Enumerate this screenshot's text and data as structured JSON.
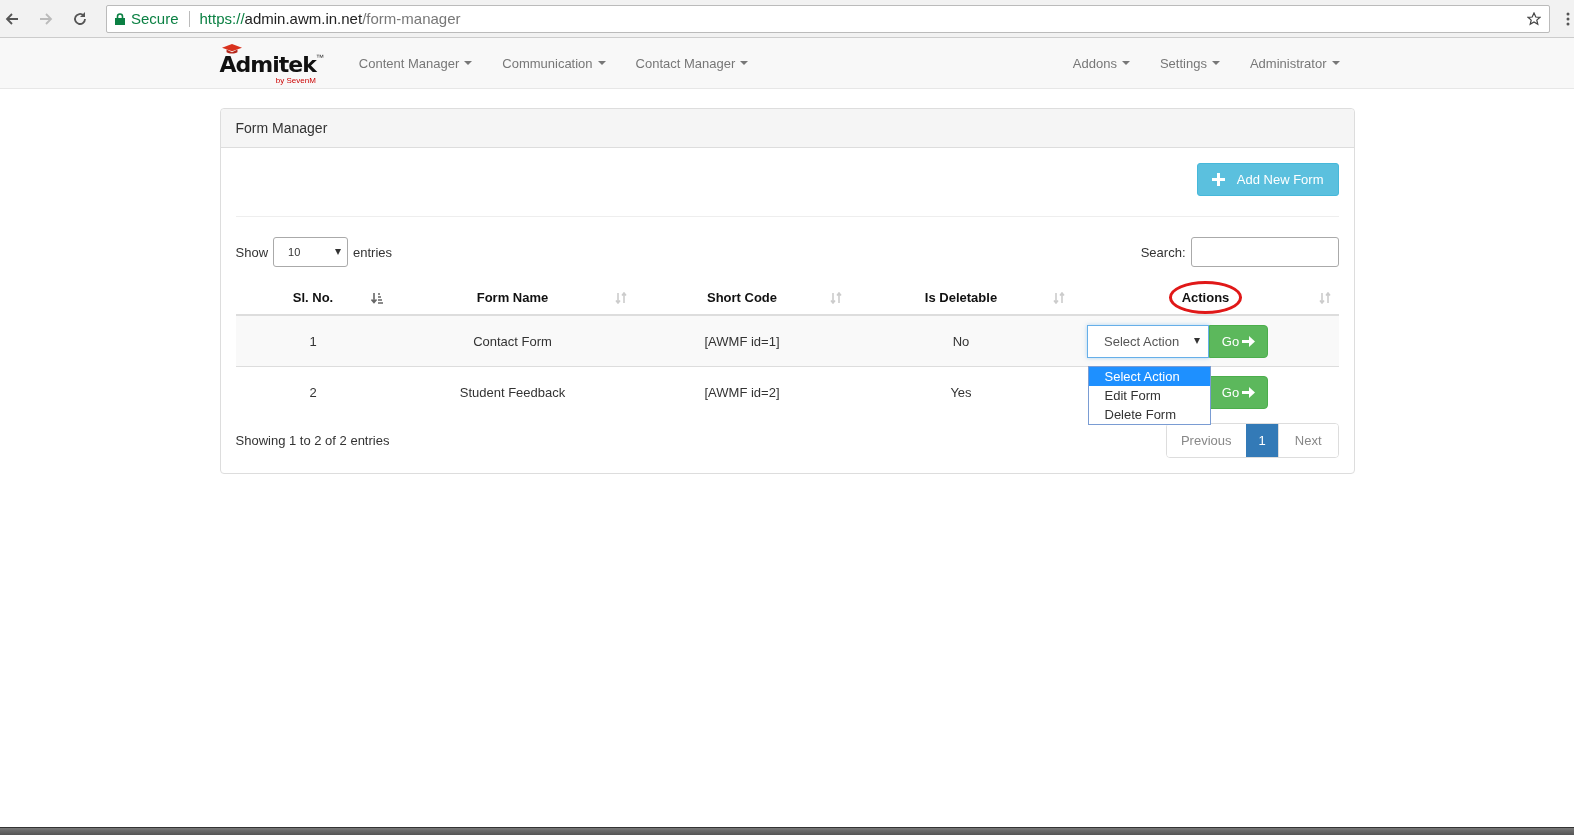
{
  "browser": {
    "secure_label": "Secure",
    "url_scheme": "https://",
    "url_host": "admin.awm.in.net",
    "url_path": "/form-manager"
  },
  "navbar": {
    "brand": "Admitek",
    "brand_mark": "™",
    "brand_sub": "by SevenM",
    "left_menus": [
      {
        "label": "Content Manager"
      },
      {
        "label": "Communication"
      },
      {
        "label": "Contact Manager"
      }
    ],
    "right_menus": [
      {
        "label": "Addons"
      },
      {
        "label": "Settings"
      },
      {
        "label": "Administrator"
      }
    ]
  },
  "panel": {
    "title": "Form Manager",
    "add_button": "Add New Form",
    "show_label": "Show",
    "page_size": "10",
    "entries_label": "entries",
    "search_label": "Search:",
    "table": {
      "columns": [
        {
          "label": "Sl. No.",
          "sorted": true,
          "highlighted": false
        },
        {
          "label": "Form Name",
          "sorted": false,
          "highlighted": false
        },
        {
          "label": "Short Code",
          "sorted": false,
          "highlighted": false
        },
        {
          "label": "Is Deletable",
          "sorted": false,
          "highlighted": false
        },
        {
          "label": "Actions",
          "sorted": false,
          "highlighted": true
        }
      ],
      "rows": [
        {
          "cells": [
            "1",
            "Contact Form",
            "[AWMF id=1]",
            "No"
          ],
          "action_select": {
            "value": "Select Action",
            "expanded": true,
            "options": [
              {
                "label": "Select Action",
                "selected": true
              },
              {
                "label": "Edit Form",
                "selected": false
              },
              {
                "label": "Delete Form",
                "selected": false
              }
            ]
          },
          "go_button": "Go"
        },
        {
          "cells": [
            "2",
            "Student Feedback",
            "[AWMF id=2]",
            "Yes"
          ],
          "go_button": "Go"
        }
      ]
    },
    "info": "Showing 1 to 2 of 2 entries",
    "pagination": [
      {
        "label": "Previous",
        "kind": "prev",
        "selected": false
      },
      {
        "label": "1",
        "kind": "page",
        "selected": true
      },
      {
        "label": "Next",
        "kind": "next",
        "selected": false
      }
    ]
  }
}
